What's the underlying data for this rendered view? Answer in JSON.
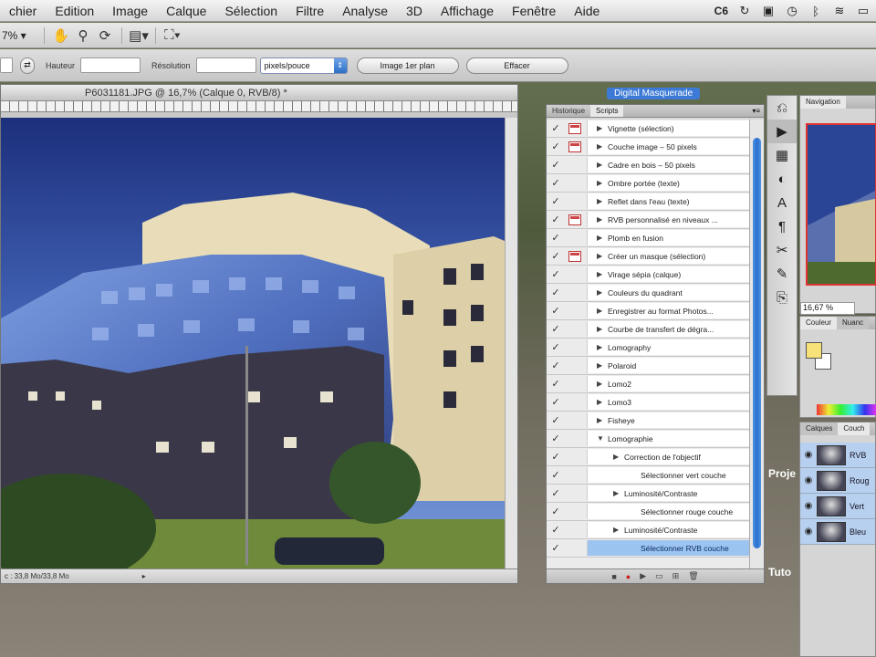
{
  "menubar": {
    "items": [
      "chier",
      "Edition",
      "Image",
      "Calque",
      "Sélection",
      "Filtre",
      "Analyse",
      "3D",
      "Affichage",
      "Fenêtre",
      "Aide"
    ],
    "status_badge": "C6"
  },
  "optbar": {
    "zoom": "7%"
  },
  "cropbar": {
    "hauteur_label": "Hauteur",
    "resolution_label": "Résolution",
    "unit_select": "pixels/pouce",
    "front_image_button": "Image 1er plan",
    "clear_button": "Effacer"
  },
  "document": {
    "title": "P6031181.JPG @ 16,7% (Calque 0, RVB/8) *",
    "status": "c : 33,8 Mo/33,8 Mo"
  },
  "actions_panel": {
    "overlay_label": "Digital Masquerade",
    "tabs": [
      "Historique",
      "Scripts"
    ],
    "rows": [
      {
        "label": "Vignette (sélection)",
        "level": 0,
        "dialog": true
      },
      {
        "label": "Couche image – 50 pixels",
        "level": 0,
        "dialog": true
      },
      {
        "label": "Cadre en bois – 50 pixels",
        "level": 0,
        "dialog": false
      },
      {
        "label": "Ombre portée (texte)",
        "level": 0,
        "dialog": false
      },
      {
        "label": "Reflet dans l'eau (texte)",
        "level": 0,
        "dialog": false
      },
      {
        "label": "RVB personnalisé en niveaux ...",
        "level": 0,
        "dialog": true
      },
      {
        "label": "Plomb en fusion",
        "level": 0,
        "dialog": false
      },
      {
        "label": "Créer un masque (sélection)",
        "level": 0,
        "dialog": true
      },
      {
        "label": "Virage sépia (calque)",
        "level": 0,
        "dialog": false
      },
      {
        "label": "Couleurs du quadrant",
        "level": 0,
        "dialog": false
      },
      {
        "label": "Enregistrer au format Photos...",
        "level": 0,
        "dialog": false
      },
      {
        "label": "Courbe de transfert de dégra...",
        "level": 0,
        "dialog": false
      },
      {
        "label": "Lomography",
        "level": 0,
        "dialog": false
      },
      {
        "label": "Polaroid",
        "level": 0,
        "dialog": false
      },
      {
        "label": "Lomo2",
        "level": 0,
        "dialog": false
      },
      {
        "label": "Lomo3",
        "level": 0,
        "dialog": false
      },
      {
        "label": "Fisheye",
        "level": 0,
        "dialog": false
      },
      {
        "label": "Lomographie",
        "level": 0,
        "dialog": false,
        "open": true
      },
      {
        "label": "Correction de l'objectif",
        "level": 1,
        "dialog": false
      },
      {
        "label": "Sélectionner vert couche",
        "level": 2,
        "dialog": false
      },
      {
        "label": "Luminosité/Contraste",
        "level": 1,
        "dialog": false
      },
      {
        "label": "Sélectionner rouge couche",
        "level": 2,
        "dialog": false
      },
      {
        "label": "Luminosité/Contraste",
        "level": 1,
        "dialog": false
      },
      {
        "label": "Sélectionner RVB couche",
        "level": 2,
        "dialog": false,
        "selected": true
      }
    ]
  },
  "navigation": {
    "tab": "Navigation",
    "zoom": "16,67 %"
  },
  "color_panel": {
    "tabs": [
      "Couleur",
      "Nuanc"
    ]
  },
  "layers_panel": {
    "tabs": [
      "Calques",
      "Couch"
    ],
    "rows": [
      "RVB",
      "Roug",
      "Vert",
      "Bleu"
    ]
  },
  "overlay": {
    "text1": "Proje",
    "text2": "Tuto"
  },
  "colors": {
    "accent": "#3d7ad6",
    "selection": "#9cc4f0"
  }
}
